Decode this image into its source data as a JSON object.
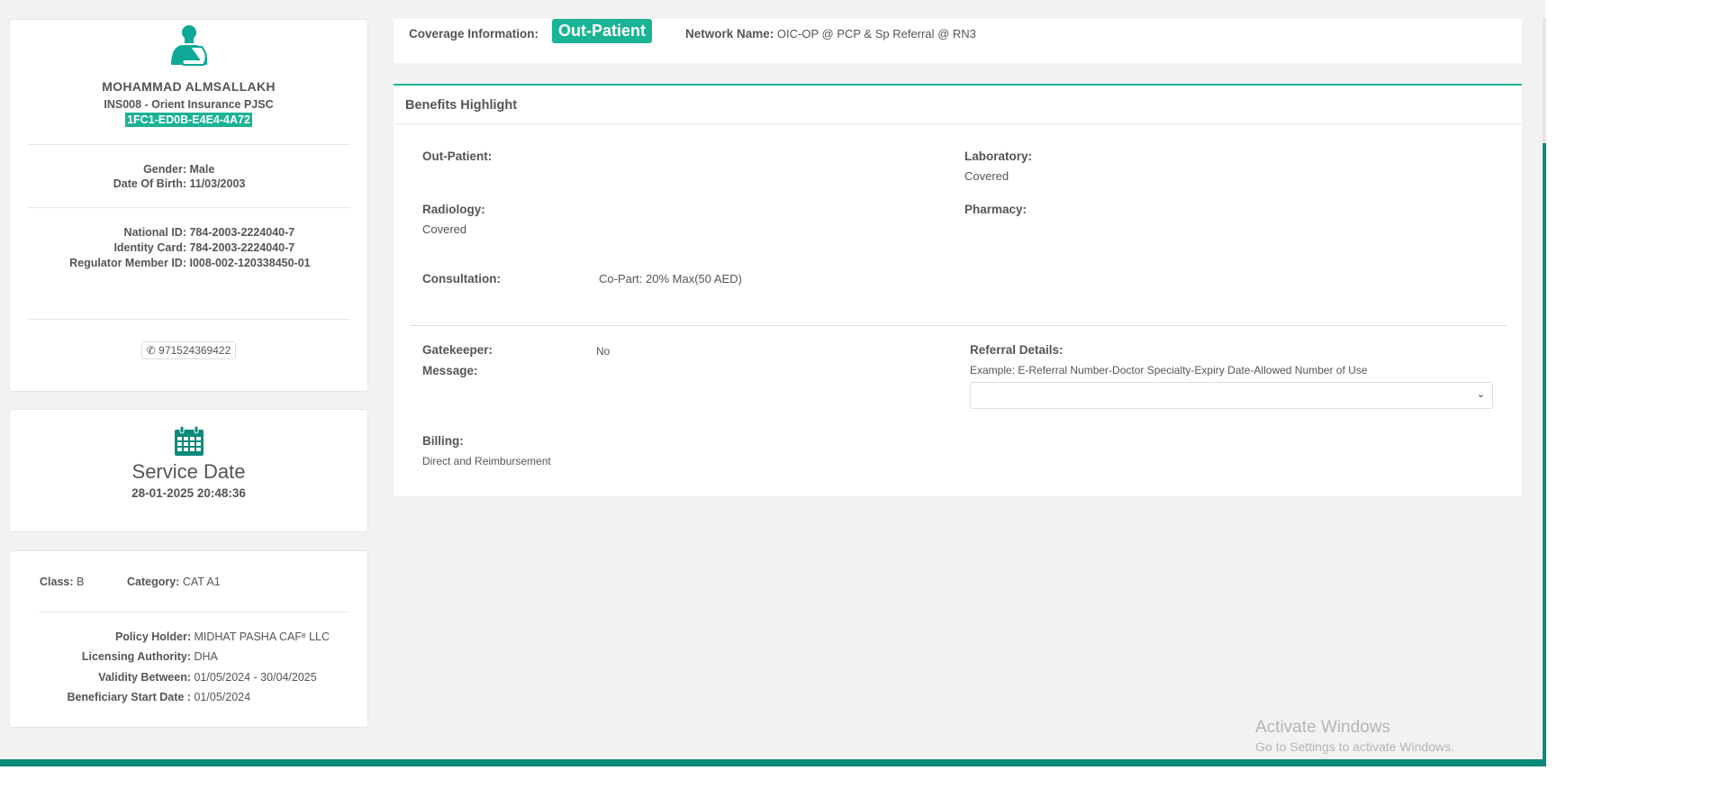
{
  "member": {
    "name": "MOHAMMAD ALMSALLAKH",
    "insurer": "INS008 - Orient Insurance PJSC",
    "card_id": "1FC1-ED0B-E4E4-4A72",
    "gender_label": "Gender:",
    "gender": "Male",
    "dob_label": "Date Of Birth:",
    "dob": "11/03/2003",
    "national_id_label": "National ID:",
    "national_id": "784-2003-2224040-7",
    "identity_card_label": "Identity Card:",
    "identity_card": "784-2003-2224040-7",
    "regulator_id_label": "Regulator Member ID:",
    "regulator_id": "I008-002-120338450-01",
    "phone": "971524369422"
  },
  "service": {
    "title": "Service Date",
    "datetime": "28-01-2025 20:48:36"
  },
  "policy": {
    "class_label": "Class:",
    "class": "B",
    "category_label": "Category:",
    "category": "CAT A1",
    "holder_label": "Policy Holder:",
    "holder": "MIDHAT PASHA CAFᵉ LLC",
    "authority_label": "Licensing Authority:",
    "authority": "DHA",
    "validity_label": "Validity Between:",
    "validity": "01/05/2024 - 30/04/2025",
    "start_label": "Beneficiary Start Date :",
    "start": "01/05/2024"
  },
  "coverage": {
    "label": "Coverage Information:",
    "type": "Out-Patient",
    "network_label": "Network Name:",
    "network": "OIC-OP @ PCP & Sp Referral @ RN3"
  },
  "benefits": {
    "title": "Benefits Highlight",
    "outpatient_label": "Out-Patient:",
    "laboratory_label": "Laboratory:",
    "laboratory": "Covered",
    "radiology_label": "Radiology:",
    "radiology": "Covered",
    "pharmacy_label": "Pharmacy:",
    "consultation_label": "Consultation:",
    "consultation": "Co-Part: 20% Max(50 AED)",
    "gatekeeper_label": "Gatekeeper:",
    "gatekeeper": "No",
    "message_label": "Message:",
    "referral_label": "Referral Details:",
    "referral_example": "Example: E-Referral Number-Doctor Specialty-Expiry Date-Allowed Number of Use",
    "billing_label": "Billing:",
    "billing": "Direct and Reimbursement"
  },
  "watermark": {
    "title": "Activate Windows",
    "subtitle": "Go to Settings to activate Windows."
  },
  "colors": {
    "accent": "#1ab394",
    "dark_teal": "#0a8a78"
  }
}
